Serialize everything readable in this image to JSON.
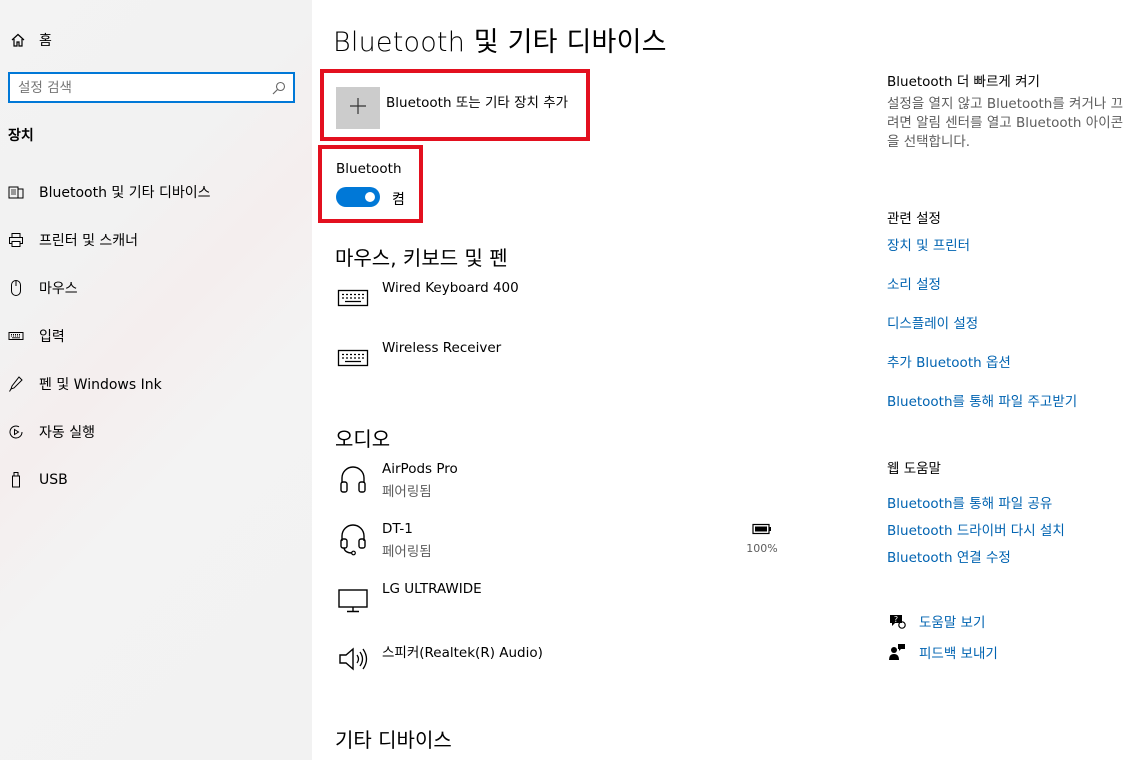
{
  "sidebar": {
    "home_label": "홈",
    "search_placeholder": "설정 검색",
    "section_label": "장치",
    "items": [
      {
        "label": "Bluetooth 및 기타 디바이스",
        "icon": "bluetooth-devices-icon"
      },
      {
        "label": "프린터 및 스캐너",
        "icon": "printer-icon"
      },
      {
        "label": "마우스",
        "icon": "mouse-icon"
      },
      {
        "label": "입력",
        "icon": "keyboard-icon"
      },
      {
        "label": "펜 및 Windows Ink",
        "icon": "pen-icon"
      },
      {
        "label": "자동 실행",
        "icon": "autoplay-icon"
      },
      {
        "label": "USB",
        "icon": "usb-icon"
      }
    ]
  },
  "main": {
    "title": "Bluetooth 및 기타 디바이스",
    "add_device_label": "Bluetooth 또는 기타 장치 추가",
    "bluetooth_label": "Bluetooth",
    "bluetooth_state": "켬",
    "bluetooth_on": true,
    "sections": {
      "input_title": "마우스, 키보드 및 펜",
      "audio_title": "오디오",
      "other_title": "기타 디바이스"
    },
    "input_devices": [
      {
        "name": "Wired Keyboard 400",
        "icon": "keyboard-icon"
      },
      {
        "name": "Wireless Receiver",
        "icon": "keyboard-icon"
      }
    ],
    "audio_devices": [
      {
        "name": "AirPods Pro",
        "status": "페어링됨",
        "icon": "headphones-icon"
      },
      {
        "name": "DT-1",
        "status": "페어링됨",
        "icon": "headset-icon",
        "battery": "100%"
      },
      {
        "name": "LG ULTRAWIDE",
        "status": "",
        "icon": "monitor-icon"
      },
      {
        "name": "스피커(Realtek(R) Audio)",
        "status": "",
        "icon": "speaker-icon"
      }
    ]
  },
  "right": {
    "swift_title": "Bluetooth 더 빠르게 켜기",
    "swift_text": "설정을 열지 않고 Bluetooth를 켜거나 끄려면 알림 센터를 열고 Bluetooth 아이콘을 선택합니다.",
    "related_title": "관련 설정",
    "related_links": [
      "장치 및 프린터",
      "소리 설정",
      "디스플레이 설정",
      "추가 Bluetooth 옵션",
      "Bluetooth를 통해 파일 주고받기"
    ],
    "web_help_title": "웹 도움말",
    "web_help_links": [
      "Bluetooth를 통해 파일 공유",
      "Bluetooth 드라이버 다시 설치",
      "Bluetooth 연결 수정"
    ],
    "get_help": "도움말 보기",
    "feedback": "피드백 보내기"
  },
  "colors": {
    "accent": "#0078d7",
    "link": "#0063b1",
    "highlight_border": "#e3101f"
  }
}
